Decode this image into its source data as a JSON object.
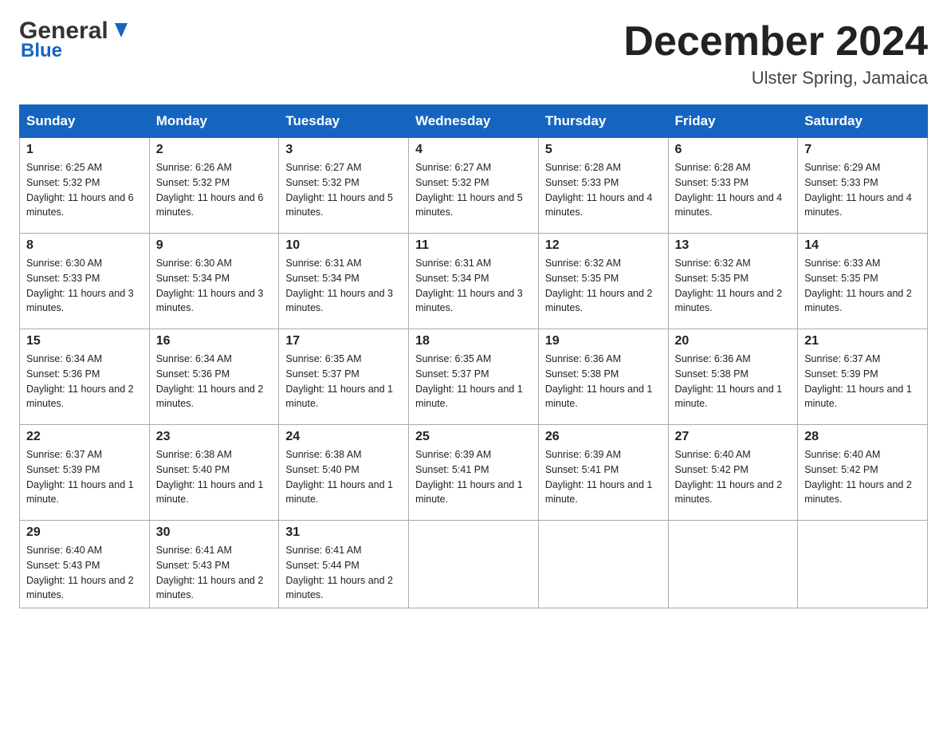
{
  "header": {
    "logo_general": "General",
    "logo_blue": "Blue",
    "month_year": "December 2024",
    "location": "Ulster Spring, Jamaica"
  },
  "days_of_week": [
    "Sunday",
    "Monday",
    "Tuesday",
    "Wednesday",
    "Thursday",
    "Friday",
    "Saturday"
  ],
  "weeks": [
    [
      {
        "day": "1",
        "sunrise": "6:25 AM",
        "sunset": "5:32 PM",
        "daylight": "11 hours and 6 minutes."
      },
      {
        "day": "2",
        "sunrise": "6:26 AM",
        "sunset": "5:32 PM",
        "daylight": "11 hours and 6 minutes."
      },
      {
        "day": "3",
        "sunrise": "6:27 AM",
        "sunset": "5:32 PM",
        "daylight": "11 hours and 5 minutes."
      },
      {
        "day": "4",
        "sunrise": "6:27 AM",
        "sunset": "5:32 PM",
        "daylight": "11 hours and 5 minutes."
      },
      {
        "day": "5",
        "sunrise": "6:28 AM",
        "sunset": "5:33 PM",
        "daylight": "11 hours and 4 minutes."
      },
      {
        "day": "6",
        "sunrise": "6:28 AM",
        "sunset": "5:33 PM",
        "daylight": "11 hours and 4 minutes."
      },
      {
        "day": "7",
        "sunrise": "6:29 AM",
        "sunset": "5:33 PM",
        "daylight": "11 hours and 4 minutes."
      }
    ],
    [
      {
        "day": "8",
        "sunrise": "6:30 AM",
        "sunset": "5:33 PM",
        "daylight": "11 hours and 3 minutes."
      },
      {
        "day": "9",
        "sunrise": "6:30 AM",
        "sunset": "5:34 PM",
        "daylight": "11 hours and 3 minutes."
      },
      {
        "day": "10",
        "sunrise": "6:31 AM",
        "sunset": "5:34 PM",
        "daylight": "11 hours and 3 minutes."
      },
      {
        "day": "11",
        "sunrise": "6:31 AM",
        "sunset": "5:34 PM",
        "daylight": "11 hours and 3 minutes."
      },
      {
        "day": "12",
        "sunrise": "6:32 AM",
        "sunset": "5:35 PM",
        "daylight": "11 hours and 2 minutes."
      },
      {
        "day": "13",
        "sunrise": "6:32 AM",
        "sunset": "5:35 PM",
        "daylight": "11 hours and 2 minutes."
      },
      {
        "day": "14",
        "sunrise": "6:33 AM",
        "sunset": "5:35 PM",
        "daylight": "11 hours and 2 minutes."
      }
    ],
    [
      {
        "day": "15",
        "sunrise": "6:34 AM",
        "sunset": "5:36 PM",
        "daylight": "11 hours and 2 minutes."
      },
      {
        "day": "16",
        "sunrise": "6:34 AM",
        "sunset": "5:36 PM",
        "daylight": "11 hours and 2 minutes."
      },
      {
        "day": "17",
        "sunrise": "6:35 AM",
        "sunset": "5:37 PM",
        "daylight": "11 hours and 1 minute."
      },
      {
        "day": "18",
        "sunrise": "6:35 AM",
        "sunset": "5:37 PM",
        "daylight": "11 hours and 1 minute."
      },
      {
        "day": "19",
        "sunrise": "6:36 AM",
        "sunset": "5:38 PM",
        "daylight": "11 hours and 1 minute."
      },
      {
        "day": "20",
        "sunrise": "6:36 AM",
        "sunset": "5:38 PM",
        "daylight": "11 hours and 1 minute."
      },
      {
        "day": "21",
        "sunrise": "6:37 AM",
        "sunset": "5:39 PM",
        "daylight": "11 hours and 1 minute."
      }
    ],
    [
      {
        "day": "22",
        "sunrise": "6:37 AM",
        "sunset": "5:39 PM",
        "daylight": "11 hours and 1 minute."
      },
      {
        "day": "23",
        "sunrise": "6:38 AM",
        "sunset": "5:40 PM",
        "daylight": "11 hours and 1 minute."
      },
      {
        "day": "24",
        "sunrise": "6:38 AM",
        "sunset": "5:40 PM",
        "daylight": "11 hours and 1 minute."
      },
      {
        "day": "25",
        "sunrise": "6:39 AM",
        "sunset": "5:41 PM",
        "daylight": "11 hours and 1 minute."
      },
      {
        "day": "26",
        "sunrise": "6:39 AM",
        "sunset": "5:41 PM",
        "daylight": "11 hours and 1 minute."
      },
      {
        "day": "27",
        "sunrise": "6:40 AM",
        "sunset": "5:42 PM",
        "daylight": "11 hours and 2 minutes."
      },
      {
        "day": "28",
        "sunrise": "6:40 AM",
        "sunset": "5:42 PM",
        "daylight": "11 hours and 2 minutes."
      }
    ],
    [
      {
        "day": "29",
        "sunrise": "6:40 AM",
        "sunset": "5:43 PM",
        "daylight": "11 hours and 2 minutes."
      },
      {
        "day": "30",
        "sunrise": "6:41 AM",
        "sunset": "5:43 PM",
        "daylight": "11 hours and 2 minutes."
      },
      {
        "day": "31",
        "sunrise": "6:41 AM",
        "sunset": "5:44 PM",
        "daylight": "11 hours and 2 minutes."
      },
      null,
      null,
      null,
      null
    ]
  ],
  "labels": {
    "sunrise": "Sunrise:",
    "sunset": "Sunset:",
    "daylight": "Daylight:"
  }
}
